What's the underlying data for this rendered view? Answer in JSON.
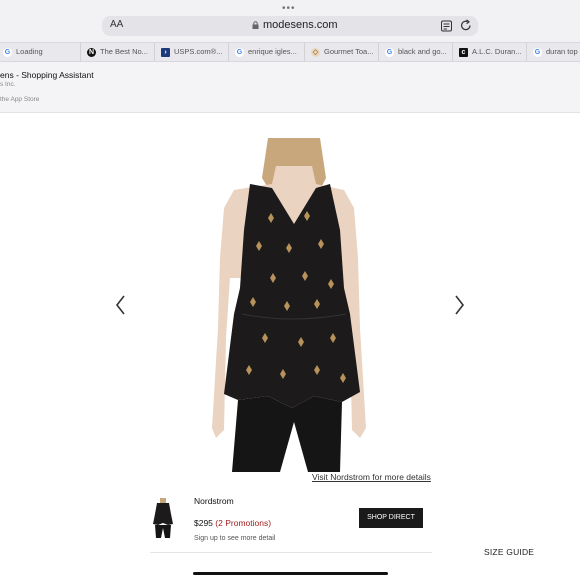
{
  "browser": {
    "text_size_label": "AA",
    "url": "modesens.com",
    "tabs": [
      {
        "label": "Loading",
        "icon": "google-icon"
      },
      {
        "label": "The Best No...",
        "icon": "site-icon"
      },
      {
        "label": "USPS.com®...",
        "icon": "usps-icon"
      },
      {
        "label": "enrique igles...",
        "icon": "google-icon"
      },
      {
        "label": "Gourmet Toa...",
        "icon": "site-icon"
      },
      {
        "label": "black and go...",
        "icon": "google-icon"
      },
      {
        "label": "A.L.C. Duran...",
        "icon": "site-icon"
      },
      {
        "label": "duran top",
        "icon": "google-icon"
      }
    ]
  },
  "banner": {
    "title": "ens - Shopping Assistant",
    "subtitle": "s Inc.",
    "store_text": "the App Store"
  },
  "product": {
    "visit_link": "Visit Nordstrom for more details"
  },
  "offer": {
    "retailer": "Nordstrom",
    "price": "$295",
    "promotions": "(2 Promotions)",
    "signup": "Sign up to see more detail",
    "shop_button": "SHOP DIRECT"
  },
  "size_guide": "SIZE GUIDE",
  "colors": {
    "promo": "#a51d1d",
    "button": "#1a1a1a"
  }
}
